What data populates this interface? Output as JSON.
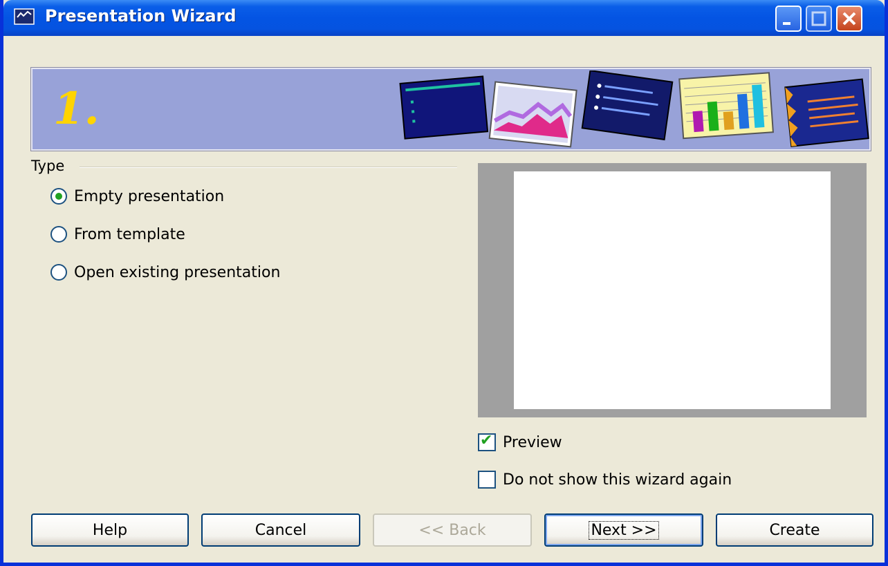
{
  "window": {
    "title": "Presentation Wizard"
  },
  "banner": {
    "step": "1."
  },
  "type_group": {
    "label": "Type",
    "options": [
      {
        "label": "Empty presentation",
        "checked": true
      },
      {
        "label": "From template",
        "checked": false
      },
      {
        "label": "Open existing presentation",
        "checked": false
      }
    ]
  },
  "options": {
    "preview_label": "Preview",
    "preview_checked": true,
    "no_show_label": "Do not show this wizard again",
    "no_show_checked": false
  },
  "buttons": {
    "help": "Help",
    "cancel": "Cancel",
    "back": "<< Back",
    "next": "Next >>",
    "create": "Create"
  },
  "colors": {
    "titlebar": "#0454e3",
    "banner": "#98a2d8",
    "radio_dot": "#21a121",
    "face": "#ece9d8"
  }
}
